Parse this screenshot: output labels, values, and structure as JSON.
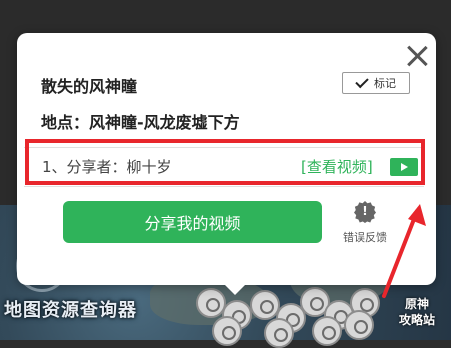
{
  "dialog": {
    "title": "散失的风神瞳",
    "mark_label": "标记",
    "location": "地点：风神瞳-风龙废墟下方",
    "share_entry": "1、分享者：柳十岁",
    "view_video_link": "[查看视频]",
    "share_video_button": "分享我的视频",
    "feedback_label": "错误反馈",
    "feedback_icon_glyph": "!"
  },
  "map": {
    "caption": "地图资源查询器",
    "logo_line1": "原神",
    "logo_line2": "攻略站"
  },
  "colors": {
    "accent_green": "#2fb35a",
    "highlight_red": "#e8262c"
  },
  "icons": {
    "close": "close-icon",
    "check": "check-icon",
    "play": "play-icon",
    "feedback": "bug-report-icon",
    "arrow": "red-arrow-annotation"
  }
}
